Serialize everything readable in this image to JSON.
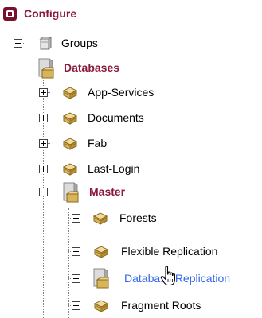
{
  "tree": {
    "root": {
      "label": "Configure",
      "icon": "configure-icon"
    },
    "groups": {
      "label": "Groups",
      "icon": "group-icon"
    },
    "databases": {
      "label": "Databases",
      "icon": "database-folder-icon"
    },
    "db_items": [
      {
        "label": "App-Services",
        "icon": "database-icon"
      },
      {
        "label": "Documents",
        "icon": "database-icon"
      },
      {
        "label": "Fab",
        "icon": "database-icon"
      },
      {
        "label": "Last-Login",
        "icon": "database-icon"
      }
    ],
    "master": {
      "label": "Master",
      "icon": "database-folder-icon"
    },
    "master_items": [
      {
        "label": "Forests",
        "icon": "forest-icon"
      },
      {
        "label": "Flexible Replication",
        "icon": "replication-icon"
      },
      {
        "label": "Database Replication",
        "icon": "database-replication-icon",
        "hovered": true
      },
      {
        "label": "Fragment Roots",
        "icon": "fragment-roots-icon"
      }
    ]
  },
  "colors": {
    "bold_label": "#8b1a3c",
    "hover_link": "#3366ee",
    "root_icon": "#7a1030"
  },
  "cursor": {
    "icon": "hand-pointer-icon"
  }
}
